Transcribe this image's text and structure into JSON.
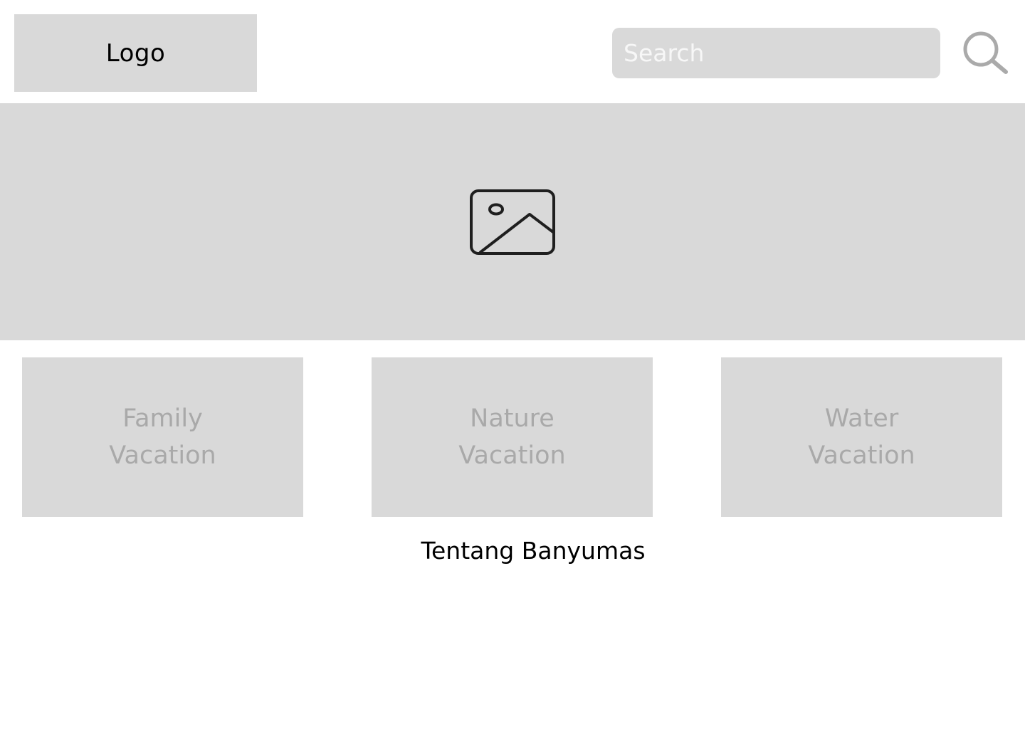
{
  "header": {
    "logo_text": "Logo",
    "search": {
      "placeholder": "Search",
      "value": ""
    },
    "search_icon": "search-icon"
  },
  "hero": {
    "image_icon": "image-placeholder-icon"
  },
  "categories": [
    {
      "label": "Family\nVacation"
    },
    {
      "label": "Nature\nVacation"
    },
    {
      "label": "Water\nVacation"
    }
  ],
  "about": {
    "title": "Tentang Banyumas"
  },
  "colors": {
    "placeholder_gray": "#d9d9d9",
    "card_text": "#a9a9a9",
    "search_icon": "#aaaaaa",
    "image_icon": "#1f1f1f"
  }
}
